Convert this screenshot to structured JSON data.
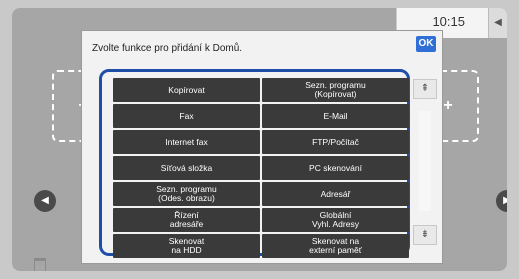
{
  "status_bar": {
    "time": "10:15",
    "tab_glyph": "◀"
  },
  "dialog": {
    "title": "Zvolte funkce pro přidání k Domů.",
    "ok_label": "OK",
    "functions": [
      "Kopírovat",
      "Sezn. programu\n(Kopírovat)",
      "Fax",
      "E-Mail",
      "Internet fax",
      "FTP/Počítač",
      "Síťová složka",
      "PC skenování",
      "Sezn. programu\n(Odes. obrazu)",
      "Adresář",
      "Řízení\nadresáře",
      "Globální\nVyhl. Adresy",
      "Skenovat\nna HDD",
      "Skenovat na\nexterní paměť"
    ],
    "scroll_up_glyph": "⇞",
    "scroll_down_glyph": "⇟"
  },
  "home": {
    "plus_glyph": "+",
    "nav_left_glyph": "◀",
    "nav_right_glyph": "▶"
  },
  "colors": {
    "accent": "#2f6fd6",
    "frame": "#1f4ea8",
    "button": "#3a3a3a",
    "screen_bg": "#a6a6a6"
  }
}
